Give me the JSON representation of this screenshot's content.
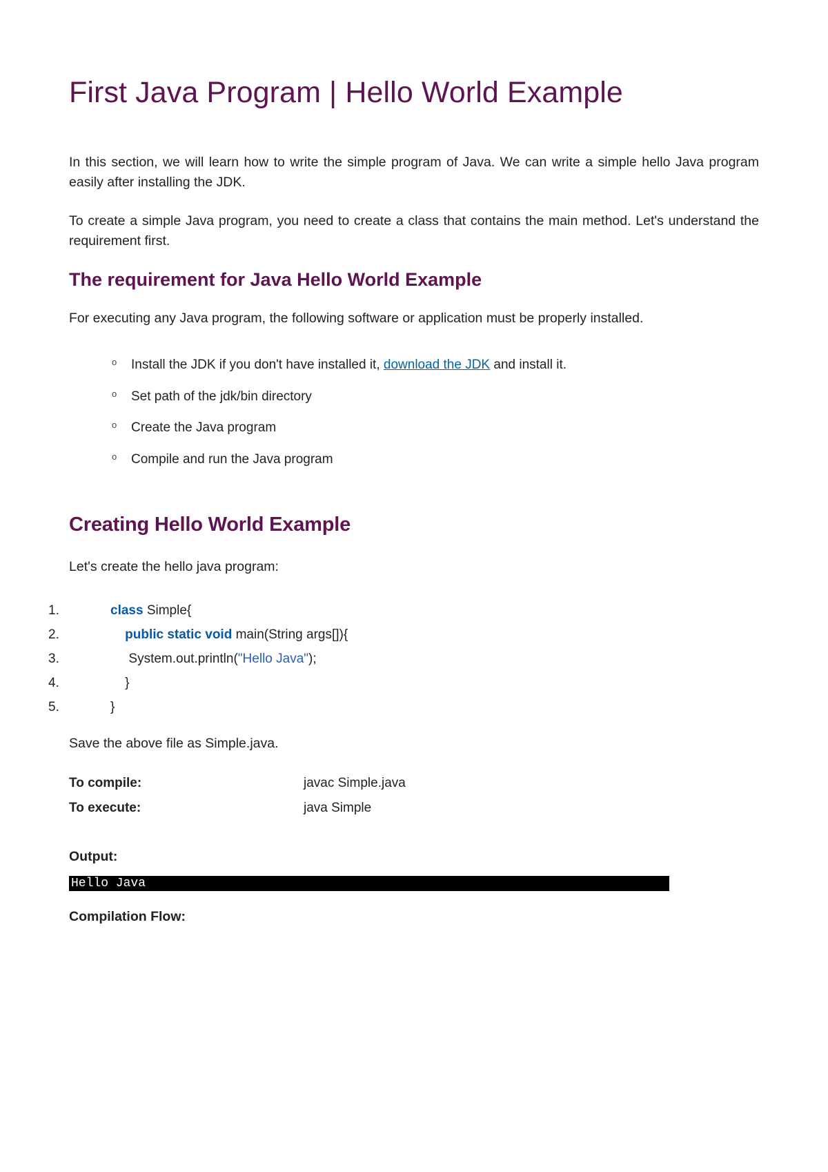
{
  "title": "First Java Program | Hello World Example",
  "intro": {
    "p1": "In this section, we will learn how to write the simple program of Java. We can write a simple hello Java program easily after installing the JDK.",
    "p2": "To create a simple Java program, you need to create a class that contains the main method. Let's understand the requirement first."
  },
  "sections": {
    "requirement": {
      "heading": "The requirement for Java Hello World Example",
      "desc": "For executing any Java program, the following software or application must be properly installed.",
      "items": {
        "i1_pre": "Install the JDK if you don't have installed it, ",
        "i1_link": "download the JDK",
        "i1_post": " and install it.",
        "i2": "Set path of the jdk/bin directory",
        "i3": "Create the Java program",
        "i4": "Compile and run the Java program"
      }
    },
    "creating": {
      "heading": "Creating Hello World Example",
      "desc": "Let's create the hello java program:"
    }
  },
  "code": {
    "l1": {
      "num": "1.",
      "kw": "class",
      "rest": " Simple{  "
    },
    "l2": {
      "num": "2.",
      "indent": "    ",
      "kw": "public static void",
      "rest": " main(String args[]){  "
    },
    "l3": {
      "num": "3.",
      "indent": "     ",
      "pre": "System.out.println(",
      "str": "\"Hello Java\"",
      "post": ");  "
    },
    "l4": {
      "num": "4.",
      "indent": "    ",
      "rest": "}  "
    },
    "l5": {
      "num": "5.",
      "rest": "}  "
    }
  },
  "save": "Save the above file as Simple.java.",
  "commands": {
    "compile_label": "To compile:",
    "compile_val": "javac Simple.java",
    "execute_label": "To execute:",
    "execute_val": "java Simple"
  },
  "output": {
    "label": "Output:",
    "text": "Hello Java"
  },
  "flow_label": "Compilation Flow:"
}
